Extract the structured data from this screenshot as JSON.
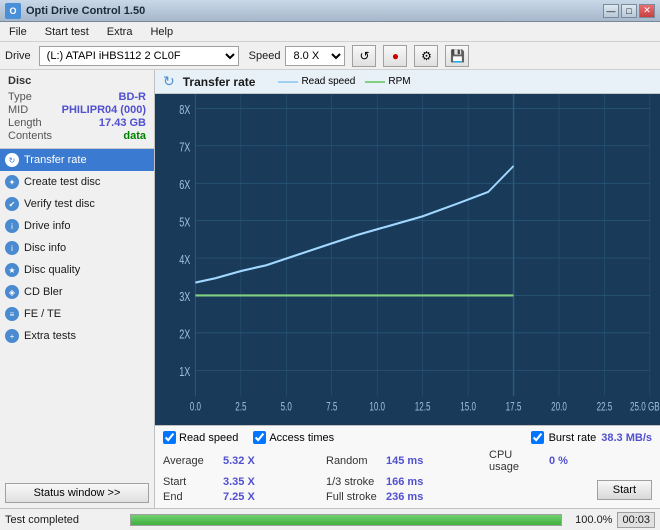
{
  "titleBar": {
    "title": "Opti Drive Control 1.50",
    "icon": "O",
    "buttons": [
      "—",
      "□",
      "✕"
    ]
  },
  "menuBar": {
    "items": [
      "File",
      "Start test",
      "Extra",
      "Help"
    ]
  },
  "driveBar": {
    "driveLabel": "Drive",
    "driveValue": "(L:)  ATAPI iHBS112  2 CL0F",
    "speedLabel": "Speed",
    "speedValue": "8.0 X",
    "icons": [
      "↺",
      "🔴",
      "🔧",
      "💾"
    ]
  },
  "disc": {
    "header": "Disc",
    "rows": [
      {
        "label": "Type",
        "value": "BD-R"
      },
      {
        "label": "MID",
        "value": "PHILIPR04 (000)"
      },
      {
        "label": "Length",
        "value": "17.43 GB"
      },
      {
        "label": "Contents",
        "value": "data"
      }
    ]
  },
  "nav": {
    "items": [
      {
        "label": "Transfer rate",
        "active": true
      },
      {
        "label": "Create test disc",
        "active": false
      },
      {
        "label": "Verify test disc",
        "active": false
      },
      {
        "label": "Drive info",
        "active": false
      },
      {
        "label": "Disc info",
        "active": false
      },
      {
        "label": "Disc quality",
        "active": false
      },
      {
        "label": "CD Bler",
        "active": false
      },
      {
        "label": "FE / TE",
        "active": false
      },
      {
        "label": "Extra tests",
        "active": false
      }
    ],
    "statusButton": "Status window >>"
  },
  "chart": {
    "title": "Transfer rate",
    "icon": "↻",
    "legend": [
      {
        "label": "Read speed",
        "color": "#a0d0f0"
      },
      {
        "label": "RPM",
        "color": "#80d080"
      }
    ],
    "yAxisLabels": [
      "8X",
      "7X",
      "6X",
      "5X",
      "4X",
      "3X",
      "2X",
      "1X"
    ],
    "xAxisLabels": [
      "0.0",
      "2.5",
      "5.0",
      "7.5",
      "10.0",
      "12.5",
      "15.0",
      "17.5",
      "20.0",
      "22.5",
      "25.0 GB"
    ],
    "checkboxes": [
      {
        "label": "Read speed",
        "checked": true
      },
      {
        "label": "Access times",
        "checked": true
      },
      {
        "label": "Burst rate",
        "checked": true
      }
    ],
    "burstRate": {
      "label": "Burst rate",
      "value": "38.3 MB/s"
    }
  },
  "stats": {
    "rows": [
      [
        {
          "label": "Average",
          "value": "5.32 X",
          "color": "blue"
        },
        {
          "label": "Random",
          "value": "145 ms",
          "color": "blue"
        },
        {
          "label": "CPU usage",
          "value": "0 %",
          "color": "blue"
        }
      ],
      [
        {
          "label": "Start",
          "value": "3.35 X",
          "color": "blue"
        },
        {
          "label": "1/3 stroke",
          "value": "166 ms",
          "color": "blue"
        },
        {
          "label": "",
          "value": "",
          "color": ""
        }
      ],
      [
        {
          "label": "End",
          "value": "7.25 X",
          "color": "blue"
        },
        {
          "label": "Full stroke",
          "value": "236 ms",
          "color": "blue"
        },
        {
          "label": "",
          "value": "",
          "color": ""
        }
      ]
    ],
    "startButton": "Start"
  },
  "statusBar": {
    "text": "Test completed",
    "progressPercent": 100,
    "progressText": "100.0%",
    "time": "00:03"
  }
}
